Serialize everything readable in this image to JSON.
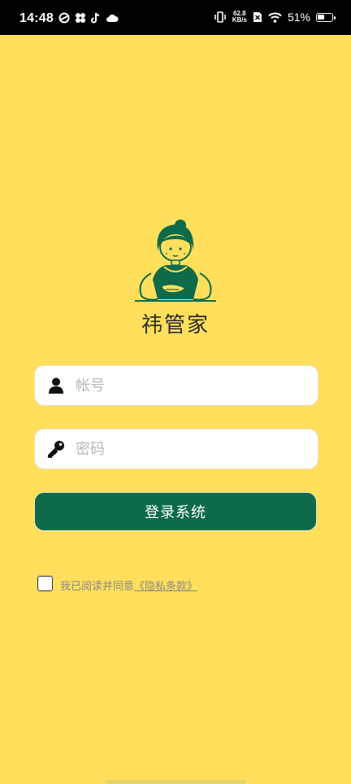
{
  "status_bar": {
    "time": "14:48",
    "net_speed_value": "62.8",
    "net_speed_unit": "KB/s",
    "battery_percent": "51%",
    "battery_level": 0.51
  },
  "app": {
    "name": "祎管家"
  },
  "login": {
    "account_placeholder": "帐号",
    "password_placeholder": "密码",
    "submit_label": "登录系统"
  },
  "agreement": {
    "text": "我已阅读并同意",
    "link": "《隐私条款》",
    "checked": false
  },
  "colors": {
    "background": "#FFDF5B",
    "primary": "#0D6B4A"
  }
}
